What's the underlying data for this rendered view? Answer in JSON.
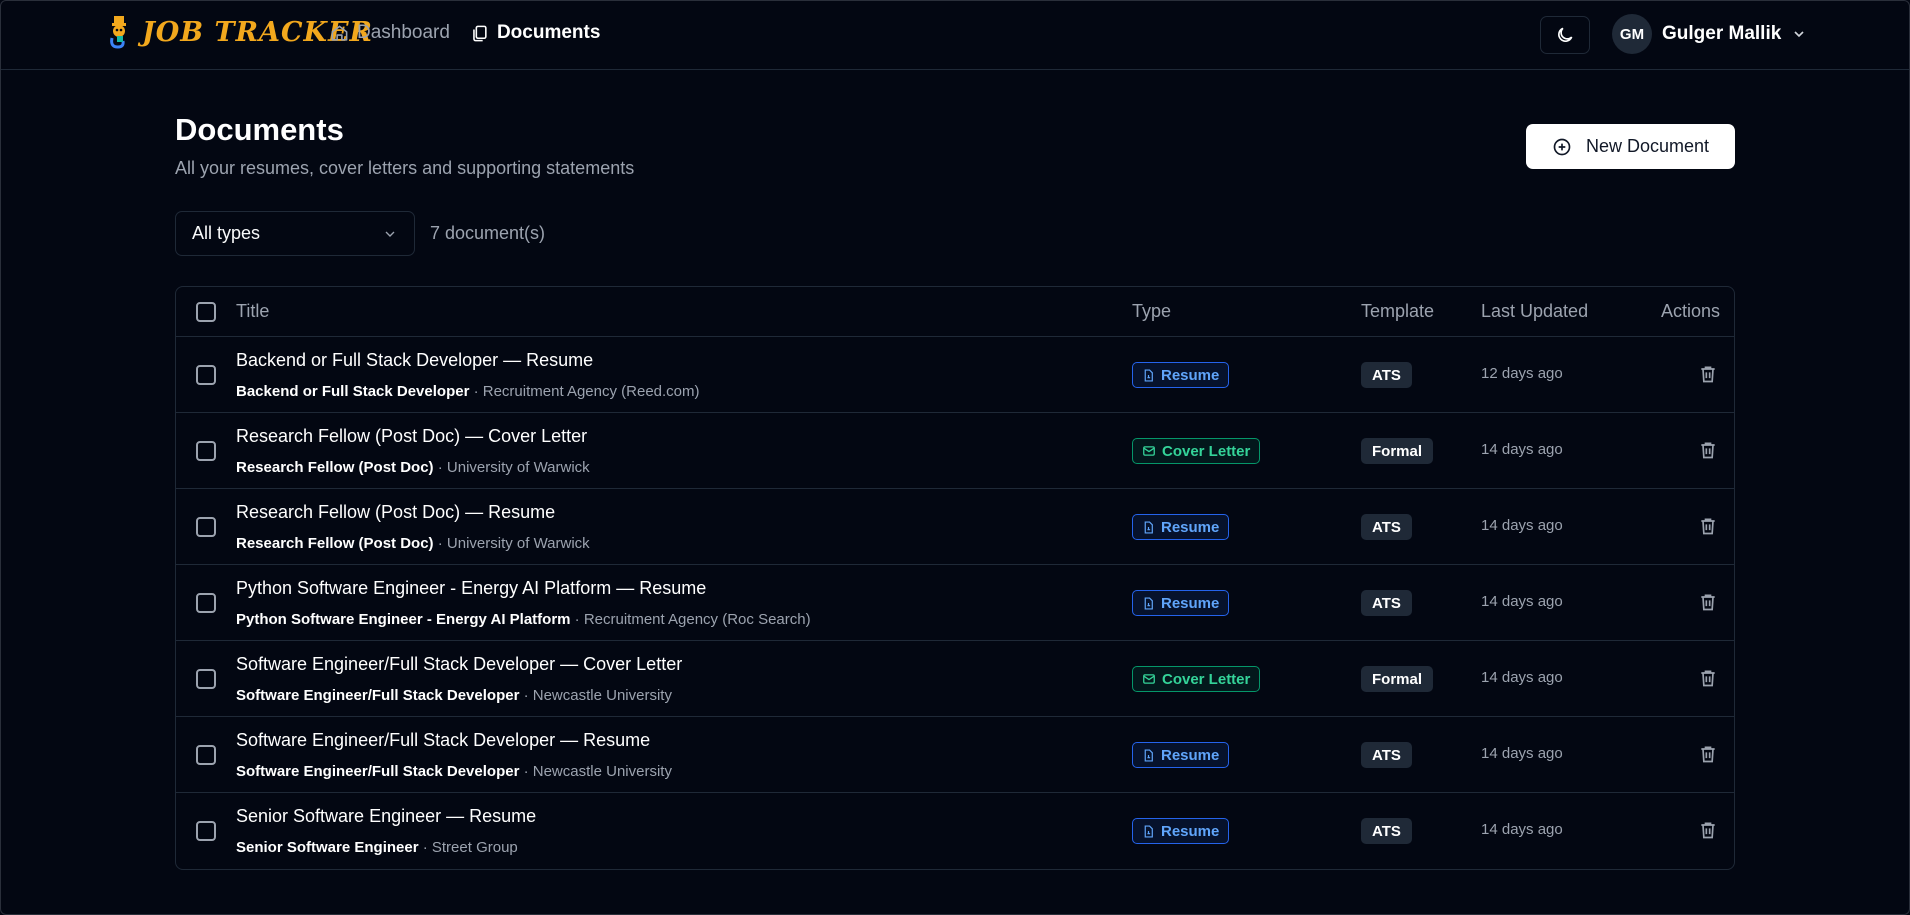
{
  "header": {
    "logo_text": "JOB TRACKER",
    "nav": [
      {
        "label": "Dashboard",
        "icon": "home-icon",
        "active": false
      },
      {
        "label": "Documents",
        "icon": "documents-icon",
        "active": true
      }
    ],
    "theme_icon": "moon-icon",
    "user": {
      "initials": "GM",
      "name": "Gulger Mallik"
    }
  },
  "page": {
    "title": "Documents",
    "subtitle": "All your resumes, cover letters and supporting statements",
    "new_button_label": "New Document"
  },
  "filter": {
    "selected": "All types",
    "count_text": "7 document(s)"
  },
  "table": {
    "columns": {
      "title": "Title",
      "type": "Type",
      "template": "Template",
      "updated": "Last Updated",
      "actions": "Actions"
    },
    "rows": [
      {
        "title": "Backend or Full Stack Developer — Resume",
        "role": "Backend or Full Stack Developer",
        "org": " · Recruitment Agency (Reed.com)",
        "type": "Resume",
        "template": "ATS",
        "updated": "12 days ago"
      },
      {
        "title": "Research Fellow (Post Doc) — Cover Letter",
        "role": "Research Fellow (Post Doc)",
        "org": " · University of Warwick",
        "type": "Cover Letter",
        "template": "Formal",
        "updated": "14 days ago"
      },
      {
        "title": "Research Fellow (Post Doc) — Resume",
        "role": "Research Fellow (Post Doc)",
        "org": " · University of Warwick",
        "type": "Resume",
        "template": "ATS",
        "updated": "14 days ago"
      },
      {
        "title": "Python Software Engineer - Energy AI Platform — Resume",
        "role": "Python Software Engineer - Energy AI Platform",
        "org": " · Recruitment Agency (Roc Search)",
        "type": "Resume",
        "template": "ATS",
        "updated": "14 days ago"
      },
      {
        "title": "Software Engineer/Full Stack Developer — Cover Letter",
        "role": "Software Engineer/Full Stack Developer",
        "org": " · Newcastle University",
        "type": "Cover Letter",
        "template": "Formal",
        "updated": "14 days ago"
      },
      {
        "title": "Software Engineer/Full Stack Developer — Resume",
        "role": "Software Engineer/Full Stack Developer",
        "org": " · Newcastle University",
        "type": "Resume",
        "template": "ATS",
        "updated": "14 days ago"
      },
      {
        "title": "Senior Software Engineer — Resume",
        "role": "Senior Software Engineer",
        "org": " · Street Group",
        "type": "Resume",
        "template": "ATS",
        "updated": "14 days ago"
      }
    ]
  },
  "colors": {
    "background": "#030712",
    "resume_badge": "#60a5fa",
    "cover_badge": "#34d399",
    "logo": "#f2a81d"
  }
}
